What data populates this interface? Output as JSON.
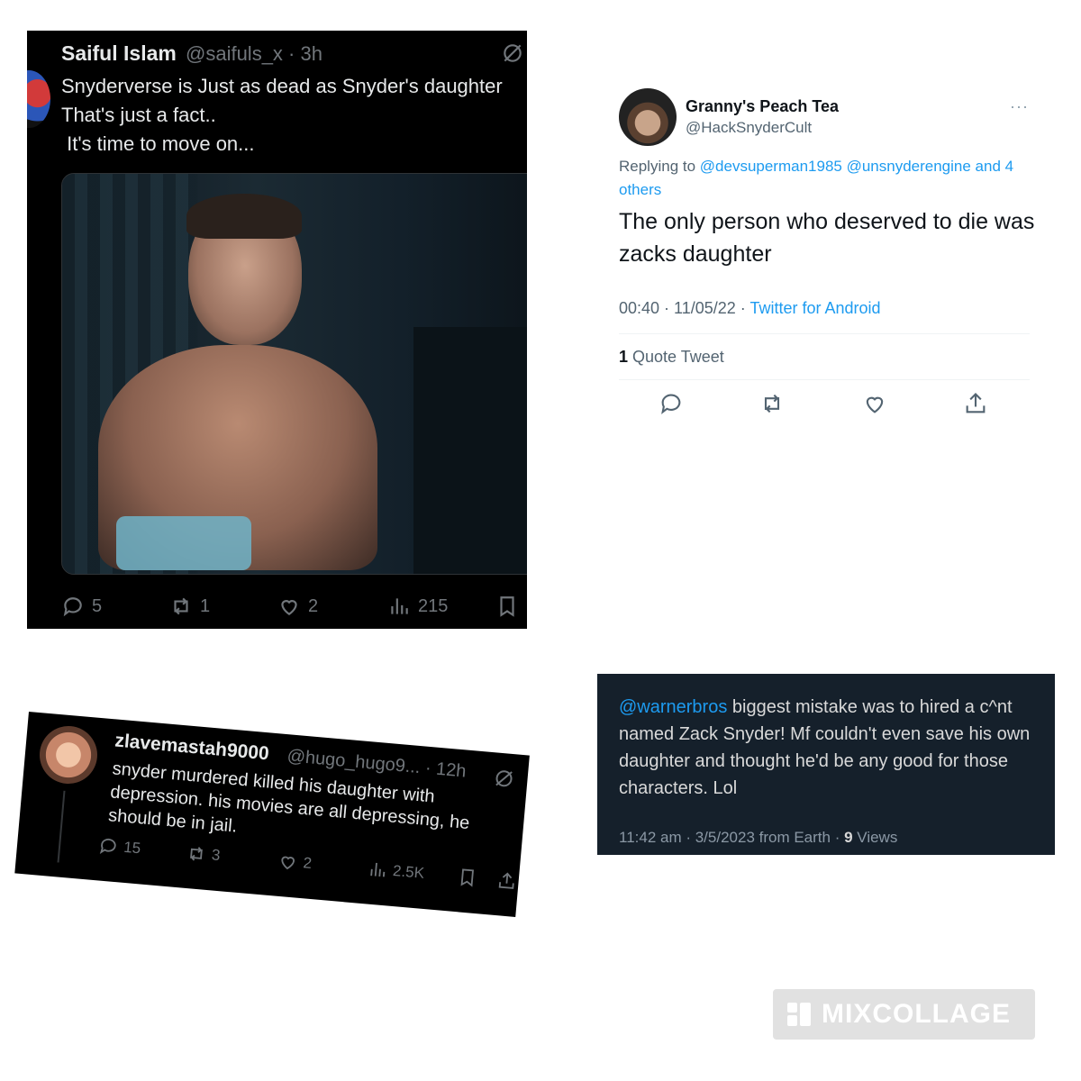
{
  "panel1": {
    "display_name": "Saiful Islam",
    "handle_time": "@saifuls_x · 3h",
    "text": "Snyderverse is Just as dead as Snyder's daughter\nThat's just a fact..\n It's time to move on...",
    "stats": {
      "replies": "5",
      "reposts": "1",
      "likes": "2",
      "views": "215"
    }
  },
  "panel2": {
    "display_name": "Granny's Peach Tea",
    "handle": "@HackSnyderCult",
    "more": "···",
    "reply_prefix": "Replying to ",
    "reply_targets": "@devsuperman1985 @unsnyderengine and 4 others",
    "text": "The only person who deserved to die was zacks daughter",
    "timestamp": "00:40 · 11/05/22 · ",
    "source": "Twitter for Android",
    "quote_count": "1",
    "quote_label": " Quote Tweet"
  },
  "panel3": {
    "display_name": "zlavemastah9000",
    "handle_time": "@hugo_hugo9... · 12h",
    "text": "snyder murdered killed his daughter with depression. his movies are all depressing, he should be in jail.",
    "stats": {
      "replies": "15",
      "reposts": "3",
      "likes": "2",
      "views": "2.5K"
    }
  },
  "panel4": {
    "mention": "@warnerbros",
    "text": " biggest mistake was to hired a c^nt named Zack Snyder! Mf couldn't even save his own daughter and thought he'd be any good for those characters. Lol",
    "meta_prefix": "11:42 am · 3/5/2023 from Earth · ",
    "views_count": "9",
    "views_label": " Views"
  },
  "watermark": {
    "text": "MIXCOLLAGE"
  },
  "colors": {
    "twitter_blue": "#1d9bf0",
    "muted": "#71767b",
    "dim_bg": "#15202b"
  }
}
